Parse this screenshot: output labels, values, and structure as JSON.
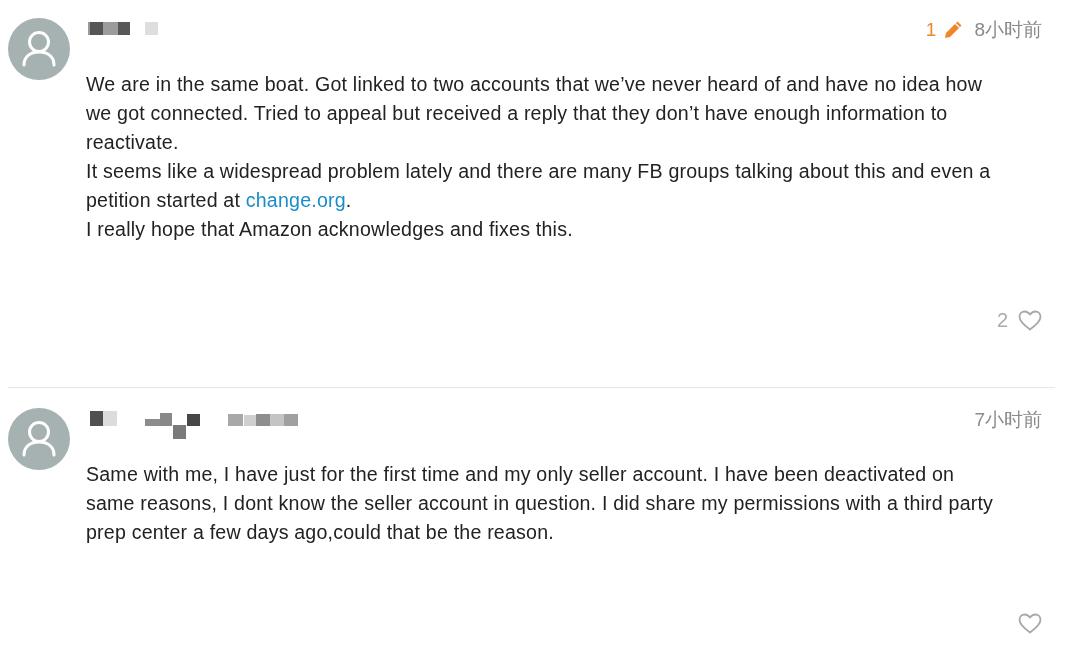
{
  "comments": [
    {
      "edits": "1",
      "time": "8小时前",
      "paragraphs": [
        [
          {
            "kind": "text",
            "text": "We are in the same boat. Got linked to two accounts that we’ve never heard of and have no idea how"
          },
          {
            "kind": "break"
          },
          {
            "kind": "text",
            "text": "we got connected. Tried to appeal but received a reply that they don’t have enough information to"
          },
          {
            "kind": "break"
          },
          {
            "kind": "text",
            "text": "reactivate."
          }
        ],
        [
          {
            "kind": "text",
            "text": "It seems like a widespread problem lately and there are many FB groups talking about this and even a"
          },
          {
            "kind": "break"
          },
          {
            "kind": "text",
            "text": "petition started at "
          },
          {
            "kind": "link",
            "text": "change.org"
          },
          {
            "kind": "text",
            "text": "."
          }
        ],
        [
          {
            "kind": "text",
            "text": "I really hope that Amazon acknowledges and fixes this."
          }
        ]
      ],
      "likes": "2",
      "liked": false
    },
    {
      "time": "7小时前",
      "paragraphs": [
        [
          {
            "kind": "text",
            "text": "Same with me, I have just for the first time and my only seller account. I have been deactivated on"
          },
          {
            "kind": "break"
          },
          {
            "kind": "text",
            "text": "same reasons, I dont know the seller account in question. I did share my permissions with a third party"
          },
          {
            "kind": "break"
          },
          {
            "kind": "text",
            "text": "prep center a few days ago,could that be the reason."
          }
        ]
      ],
      "liked": false
    }
  ]
}
